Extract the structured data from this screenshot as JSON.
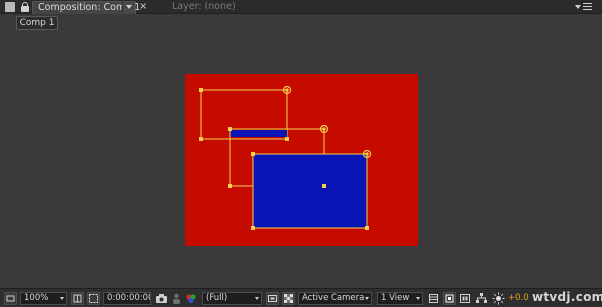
{
  "panel": {
    "tab_title": "Composition: Comp 1",
    "close_glyph": "×",
    "layer_tab": "Layer: (none)"
  },
  "subtab": {
    "label": "Comp 1"
  },
  "composition": {
    "background_color": "#c50a00",
    "layer_color": "#0a14b4",
    "handle_color": "#f5d04a"
  },
  "toolbar": {
    "zoom": "100%",
    "timecode": "0:00:00:00",
    "resolution": "(Full)",
    "camera": "Active Camera",
    "views": "1 View",
    "exposure": "+0.0"
  },
  "icons": [
    "panel-grip-icon",
    "lock-icon",
    "menu-icon",
    "camera-snapshot-icon",
    "show-snapshot-icon",
    "color-channel-icon",
    "region-icon",
    "transparency-grid-icon",
    "grid-icon",
    "pixel-aspect-icon",
    "fast-preview-icon",
    "flowchart-icon",
    "reset-exposure-icon"
  ],
  "watermark": "wtvdj.com"
}
